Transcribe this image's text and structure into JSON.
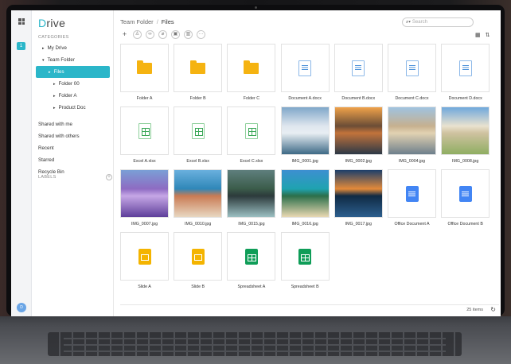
{
  "app": {
    "name": "Drive"
  },
  "sidebar": {
    "categories_label": "CATEGORIES",
    "items": [
      {
        "label": "My Drive",
        "caret": "▸",
        "level": 1
      },
      {
        "label": "Team Folder",
        "caret": "▾",
        "level": 1
      },
      {
        "label": "Files",
        "caret": "▸",
        "level": 2,
        "active": true
      },
      {
        "label": "Folder 00",
        "caret": "▸",
        "level": 3
      },
      {
        "label": "Folder A",
        "caret": "▸",
        "level": 3
      },
      {
        "label": "Product Doc",
        "caret": "▸",
        "level": 3
      },
      {
        "label": "Shared with me",
        "level": 0
      },
      {
        "label": "Shared with others",
        "level": 0
      },
      {
        "label": "Recent",
        "level": 0
      },
      {
        "label": "Starred",
        "level": 0
      },
      {
        "label": "Recycle Bin",
        "level": 0
      }
    ],
    "labels_label": "LABELS",
    "labels_add": "+"
  },
  "rail": {
    "badge": "1",
    "avatar": "D"
  },
  "header": {
    "breadcrumb": [
      "Team Folder",
      "Files"
    ],
    "separator": "/",
    "search_placeholder": "Search"
  },
  "toolbar": {
    "buttons": [
      "add-icon",
      "add-user-icon",
      "link-icon",
      "attach-icon",
      "copy-icon",
      "delete-icon",
      "more-icon"
    ]
  },
  "files": [
    {
      "name": "Folder A",
      "type": "folder"
    },
    {
      "name": "Folder B",
      "type": "folder"
    },
    {
      "name": "Folder C",
      "type": "folder"
    },
    {
      "name": "Document A.docx",
      "type": "docx"
    },
    {
      "name": "Document B.docx",
      "type": "docx"
    },
    {
      "name": "Document C.docx",
      "type": "docx"
    },
    {
      "name": "Document D.docx",
      "type": "docx"
    },
    {
      "name": "Excel A.xlsx",
      "type": "xlsx"
    },
    {
      "name": "Excel B.xlsx",
      "type": "xlsx"
    },
    {
      "name": "Excel C.xlsx",
      "type": "xlsx"
    },
    {
      "name": "IMG_0001.jpg",
      "type": "image",
      "palette": [
        "#7fa7c9",
        "#dfe6ee",
        "#3d6a86",
        "#e8eef3"
      ]
    },
    {
      "name": "IMG_0002.jpg",
      "type": "image",
      "palette": [
        "#f0a24a",
        "#6b4d36",
        "#2c3846",
        "#c2733b"
      ]
    },
    {
      "name": "IMG_0004.jpg",
      "type": "image",
      "palette": [
        "#9fc3e0",
        "#c6b08f",
        "#6e7f8c",
        "#e2d2b2"
      ]
    },
    {
      "name": "IMG_0008.jpg",
      "type": "image",
      "palette": [
        "#6fa8dc",
        "#e9e2cf",
        "#8fae62",
        "#cfc2a0"
      ]
    },
    {
      "name": "IMG_0007.jpg",
      "type": "image",
      "palette": [
        "#7a9fd6",
        "#8e6bc2",
        "#5e3f9a",
        "#c6a7e6"
      ]
    },
    {
      "name": "IMG_0010.jpg",
      "type": "image",
      "palette": [
        "#6ab0de",
        "#2f87b8",
        "#e8d7c0",
        "#c97b54"
      ]
    },
    {
      "name": "IMG_0015.jpg",
      "type": "image",
      "palette": [
        "#5f7f7d",
        "#3b5c4a",
        "#9bbfc2",
        "#2c3a3b"
      ]
    },
    {
      "name": "IMG_0016.jpg",
      "type": "image",
      "palette": [
        "#3d8fd1",
        "#1fa3b0",
        "#e9d8b2",
        "#2c6f4a"
      ]
    },
    {
      "name": "IMG_0017.jpg",
      "type": "image",
      "palette": [
        "#1d3f6a",
        "#e38a3a",
        "#2d5f8e",
        "#0f2a44"
      ]
    },
    {
      "name": "Office Document A",
      "type": "gdoc"
    },
    {
      "name": "Office Document B",
      "type": "gdoc"
    },
    {
      "name": "Slide A",
      "type": "gslide"
    },
    {
      "name": "Slide B",
      "type": "gslide"
    },
    {
      "name": "Spreadsheet A",
      "type": "gsheet"
    },
    {
      "name": "Spreadsheet B",
      "type": "gsheet"
    }
  ],
  "status": {
    "count": "25 items",
    "refresh_icon": "refresh-icon"
  }
}
